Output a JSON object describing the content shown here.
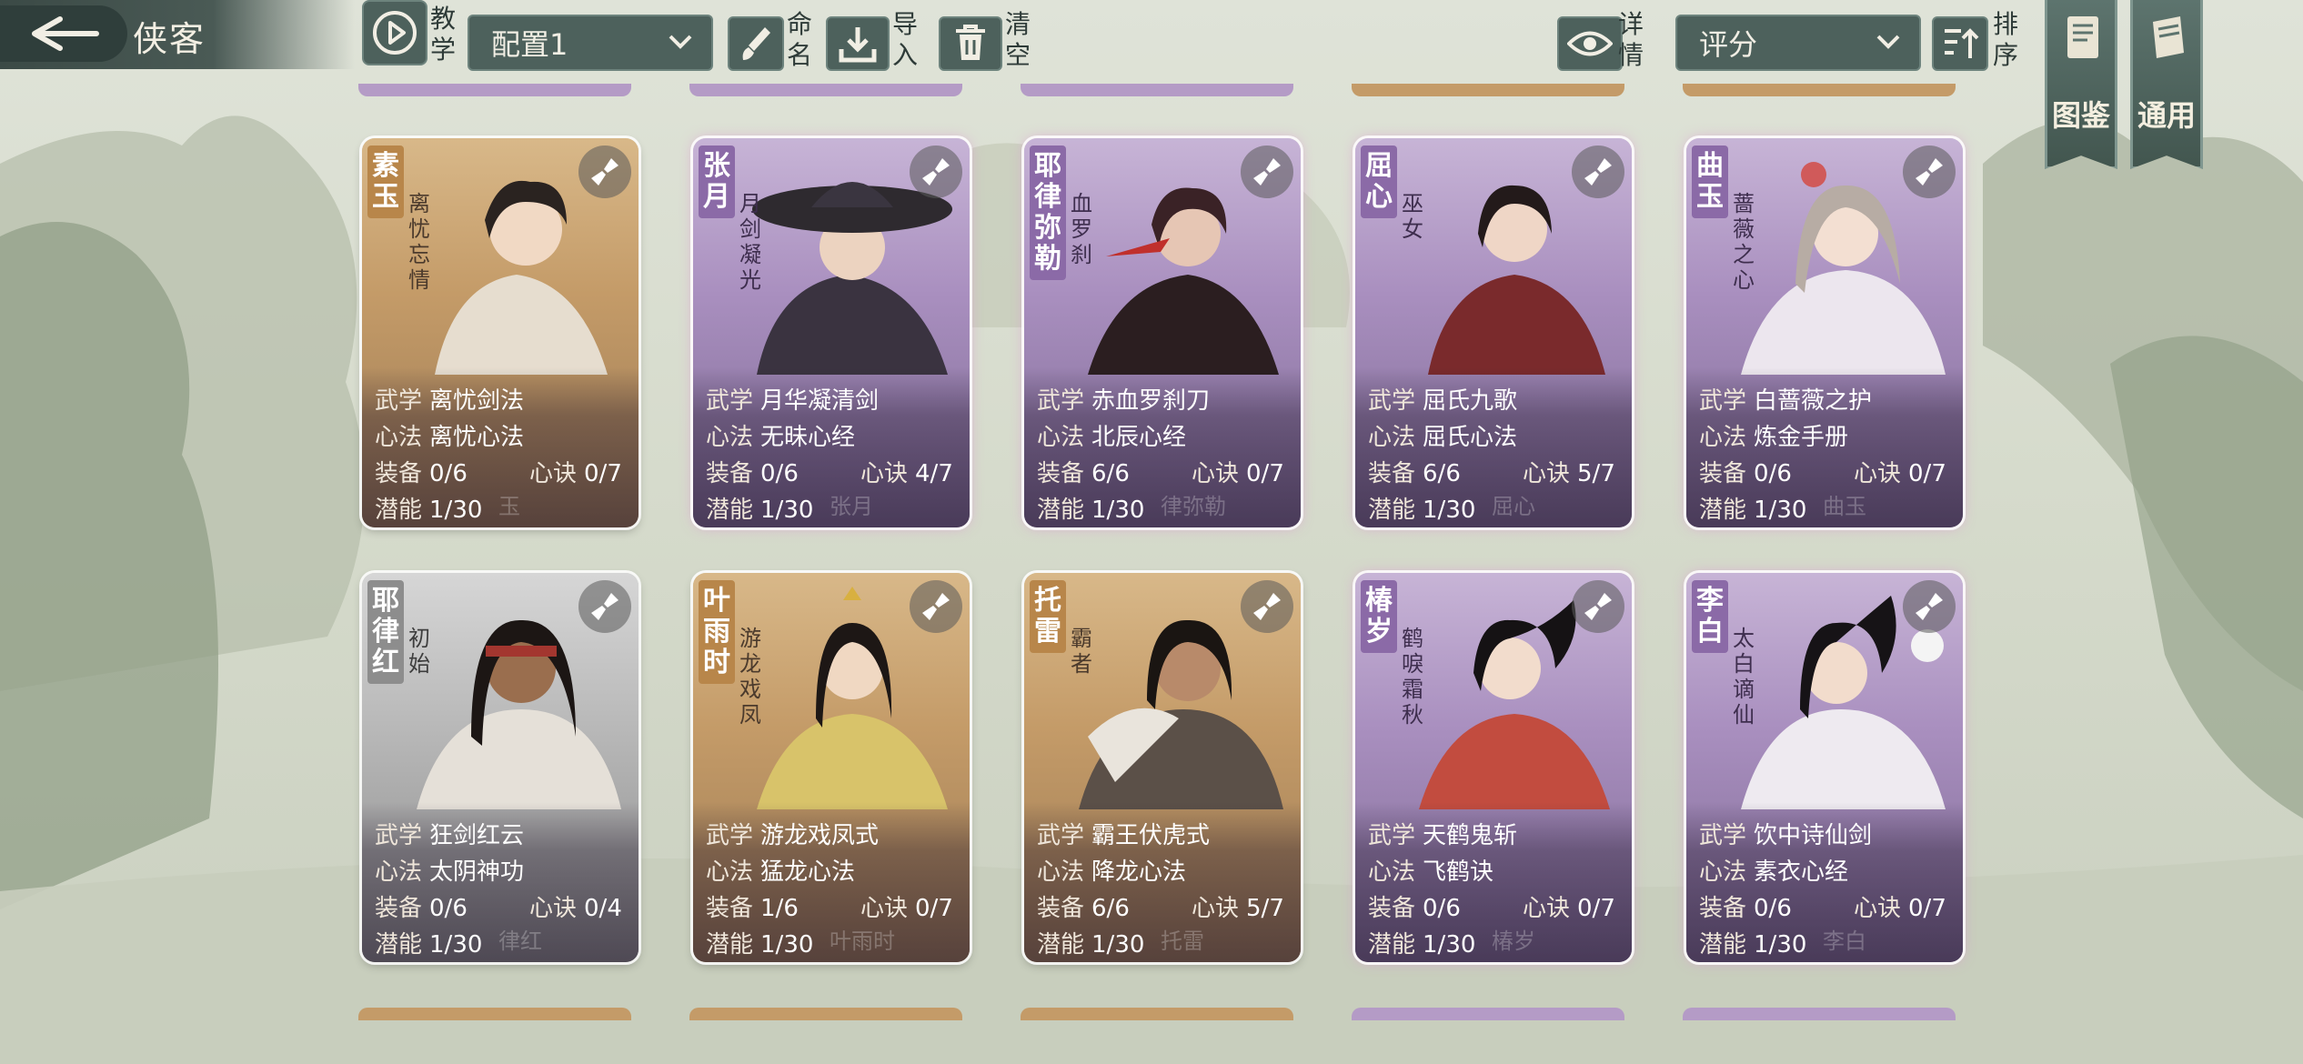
{
  "header": {
    "back_label": "",
    "title": "侠客",
    "tutorial_label": "教学",
    "config_select": "配置1",
    "rename_label": "命名",
    "import_label": "导入",
    "clear_label": "清空",
    "details_label": "详情",
    "sort_select": "评分",
    "sort_label": "排序",
    "codex_label": "图鉴",
    "general_label": "通用"
  },
  "labels": {
    "martial": "武学",
    "method": "心法",
    "equip": "装备",
    "secret": "心诀",
    "potential": "潜能"
  },
  "cards": [
    {
      "name": "素玉",
      "title": "离忧忘情",
      "rarity": "gold",
      "martial": "离忧剑法",
      "method": "离忧心法",
      "equip": "0/6",
      "secret": "0/7",
      "potential": "1/30",
      "ghost": "玉"
    },
    {
      "name": "张月",
      "title": "月剑凝光",
      "rarity": "purple",
      "martial": "月华凝清剑",
      "method": "无昧心经",
      "equip": "0/6",
      "secret": "4/7",
      "potential": "1/30",
      "ghost": "张月"
    },
    {
      "name": "耶律弥勒",
      "title": "血罗刹",
      "rarity": "purple",
      "martial": "赤血罗刹刀",
      "method": "北辰心经",
      "equip": "6/6",
      "secret": "0/7",
      "potential": "1/30",
      "ghost": "律弥勒"
    },
    {
      "name": "屈心",
      "title": "巫女",
      "rarity": "purple",
      "martial": "屈氏九歌",
      "method": "屈氏心法",
      "equip": "6/6",
      "secret": "5/7",
      "potential": "1/30",
      "ghost": "屈心"
    },
    {
      "name": "曲玉",
      "title": "蔷薇之心",
      "rarity": "purple",
      "martial": "白蔷薇之护",
      "method": "炼金手册",
      "equip": "0/6",
      "secret": "0/7",
      "potential": "1/30",
      "ghost": "曲玉"
    },
    {
      "name": "耶律红",
      "title": "初始",
      "rarity": "silver",
      "martial": "狂剑红云",
      "method": "太阴神功",
      "equip": "0/6",
      "secret": "0/4",
      "potential": "1/30",
      "ghost": "律红"
    },
    {
      "name": "叶雨时",
      "title": "游龙戏凤",
      "rarity": "gold",
      "martial": "游龙戏凤式",
      "method": "猛龙心法",
      "equip": "1/6",
      "secret": "0/7",
      "potential": "1/30",
      "ghost": "叶雨时"
    },
    {
      "name": "托雷",
      "title": "霸者",
      "rarity": "gold",
      "martial": "霸王伏虎式",
      "method": "降龙心法",
      "equip": "6/6",
      "secret": "5/7",
      "potential": "1/30",
      "ghost": "托雷"
    },
    {
      "name": "椿岁",
      "title": "鹤唳霜秋",
      "rarity": "purple",
      "martial": "天鹤鬼斩",
      "method": "飞鹤诀",
      "equip": "0/6",
      "secret": "0/7",
      "potential": "1/30",
      "ghost": "椿岁"
    },
    {
      "name": "李白",
      "title": "太白谪仙",
      "rarity": "purple",
      "martial": "饮中诗仙剑",
      "method": "素衣心经",
      "equip": "0/6",
      "secret": "0/7",
      "potential": "1/30",
      "ghost": "李白"
    }
  ],
  "colors": {
    "gold": "#c49b68",
    "purple": "#a98fbf",
    "silver": "#b8b8b8",
    "header": "#4d615c"
  }
}
